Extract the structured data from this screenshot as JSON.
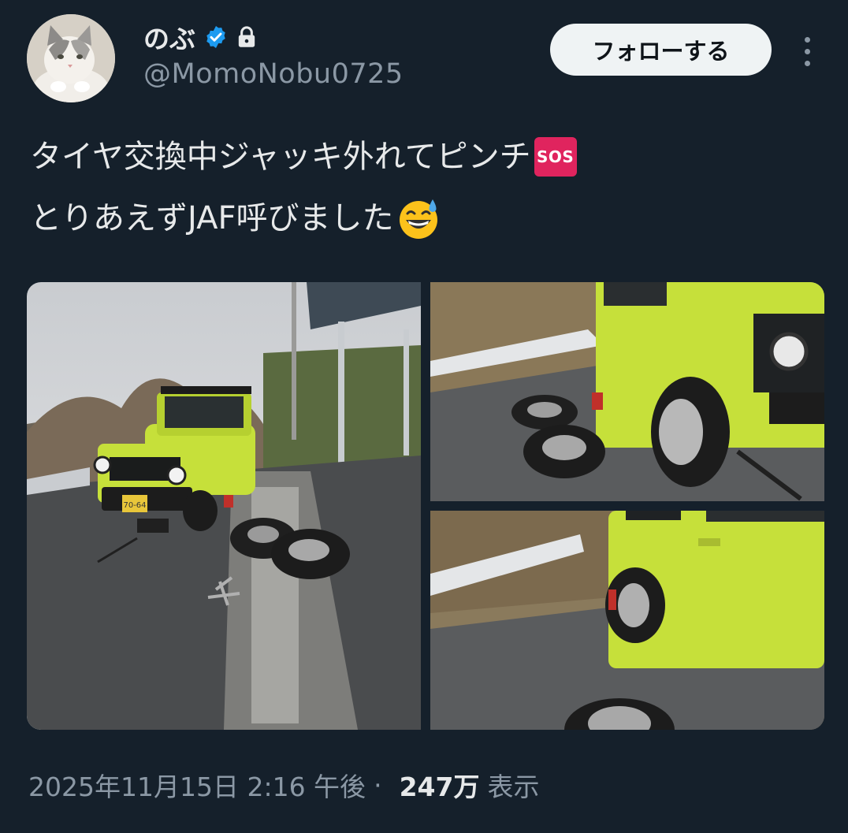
{
  "user": {
    "display_name": "のぶ",
    "handle": "@MomoNobu0725",
    "avatar": "cat-avatar",
    "verified_icon": "verified-badge-icon",
    "lock_icon": "lock-icon"
  },
  "actions": {
    "follow_label": "フォローする",
    "more_icon": "more-vertical-icon"
  },
  "tweet": {
    "line1": "タイヤ交換中ジャッキ外れてピンチ",
    "line1_emoji": "SOS",
    "line2": "とりあえずJAF呼びました",
    "line2_emoji": "grinning-sweat-emoji"
  },
  "media": {
    "plate_text": "70-64",
    "photos": [
      "yellow-jimny-on-jack-photo",
      "front-wheel-close-up-photo",
      "rear-wheel-side-photo"
    ]
  },
  "meta": {
    "timestamp": "2025年11月15日 2:16 午後",
    "separator": "·",
    "views_count": "247万",
    "views_label": "表示"
  },
  "colors": {
    "background": "#15202b",
    "text_primary": "#e7e9ea",
    "text_secondary": "#8b98a5",
    "verified": "#1d9bf0",
    "follow_bg": "#eff3f4",
    "car_yellow": "#c6e03a"
  }
}
